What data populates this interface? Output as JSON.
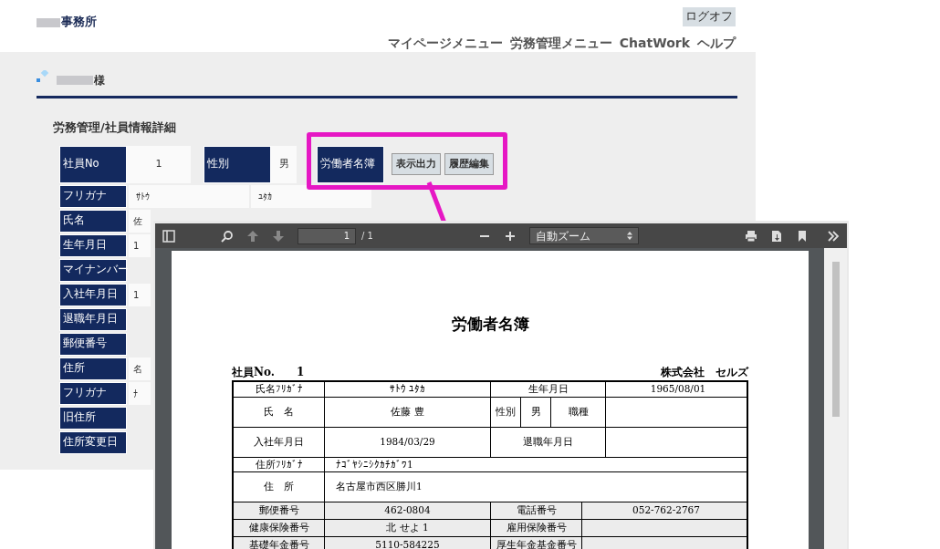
{
  "header": {
    "office_name": "事務所",
    "logoff": "ログオフ",
    "menu": [
      "マイページメニュー",
      "労務管理メニュー",
      "ChatWork",
      "ヘルプ"
    ]
  },
  "user": {
    "suffix": "様"
  },
  "page_title": "労務管理/社員情報詳細",
  "top_row": [
    {
      "kind": "field",
      "label": "社員No",
      "value": "1"
    },
    {
      "kind": "field",
      "label": "性別",
      "value": "男"
    },
    {
      "kind": "actions",
      "label": "労働者名簿",
      "buttons": [
        "表示出力",
        "履歴編集"
      ]
    }
  ],
  "rows": [
    {
      "label": "フリガナ",
      "values": [
        "ｻﾄｳ",
        "ﾕﾀｶ"
      ]
    },
    {
      "label": "氏名",
      "values": [
        "佐"
      ]
    },
    {
      "label": "生年月日",
      "values": [
        "1"
      ]
    },
    {
      "label": "マイナンバー"
    },
    {
      "label": "入社年月日",
      "values": [
        "1"
      ]
    },
    {
      "label": "退職年月日"
    },
    {
      "label": "郵便番号"
    },
    {
      "label": "住所",
      "values": [
        "名"
      ]
    },
    {
      "label": "フリガナ",
      "values": [
        "ﾅ"
      ]
    },
    {
      "label": "旧住所"
    },
    {
      "label": "住所変更日"
    }
  ],
  "pdf_viewer": {
    "page_input": "1",
    "page_count": "/ 1",
    "zoom": "自動ズーム",
    "document": {
      "title": "労働者名簿",
      "employee_no_label": "社員No.",
      "employee_no": "1",
      "company": "株式会社　セルズ",
      "rows": [
        {
          "kind": "pair_short",
          "cells": [
            "氏名ﾌﾘｶﾞﾅ",
            "ｻﾄｳ ﾕﾀｶ",
            "生年月日",
            "1965/08/01"
          ]
        },
        {
          "kind": "gender",
          "cells": [
            "氏　名",
            "佐藤 豊"
          ],
          "sub_cells": [
            "性別",
            "男",
            "職種"
          ]
        },
        {
          "kind": "pair_tall",
          "cells": [
            "入社年月日",
            "1984/03/29",
            "退職年月日"
          ]
        },
        {
          "kind": "line",
          "cells": [
            "住所ﾌﾘｶﾞﾅ",
            "ﾅｺﾞﾔｼﾆｼｸｶﾁｶﾞﾜ1"
          ]
        },
        {
          "kind": "block",
          "cells": [
            "住　所",
            "名古屋市西区勝川1"
          ]
        },
        {
          "kind": "pair_alt",
          "cells": [
            "郵便番号",
            "462-0804",
            "電話番号",
            "052-762-2767"
          ]
        },
        {
          "kind": "pair_alt",
          "cells": [
            "健康保険番号",
            "北 せよ 1",
            "雇用保険番号"
          ]
        },
        {
          "kind": "pair_alt",
          "cells": [
            "基礎年金番号",
            "5110-584225",
            "厚生年金基金番号"
          ]
        }
      ]
    }
  }
}
